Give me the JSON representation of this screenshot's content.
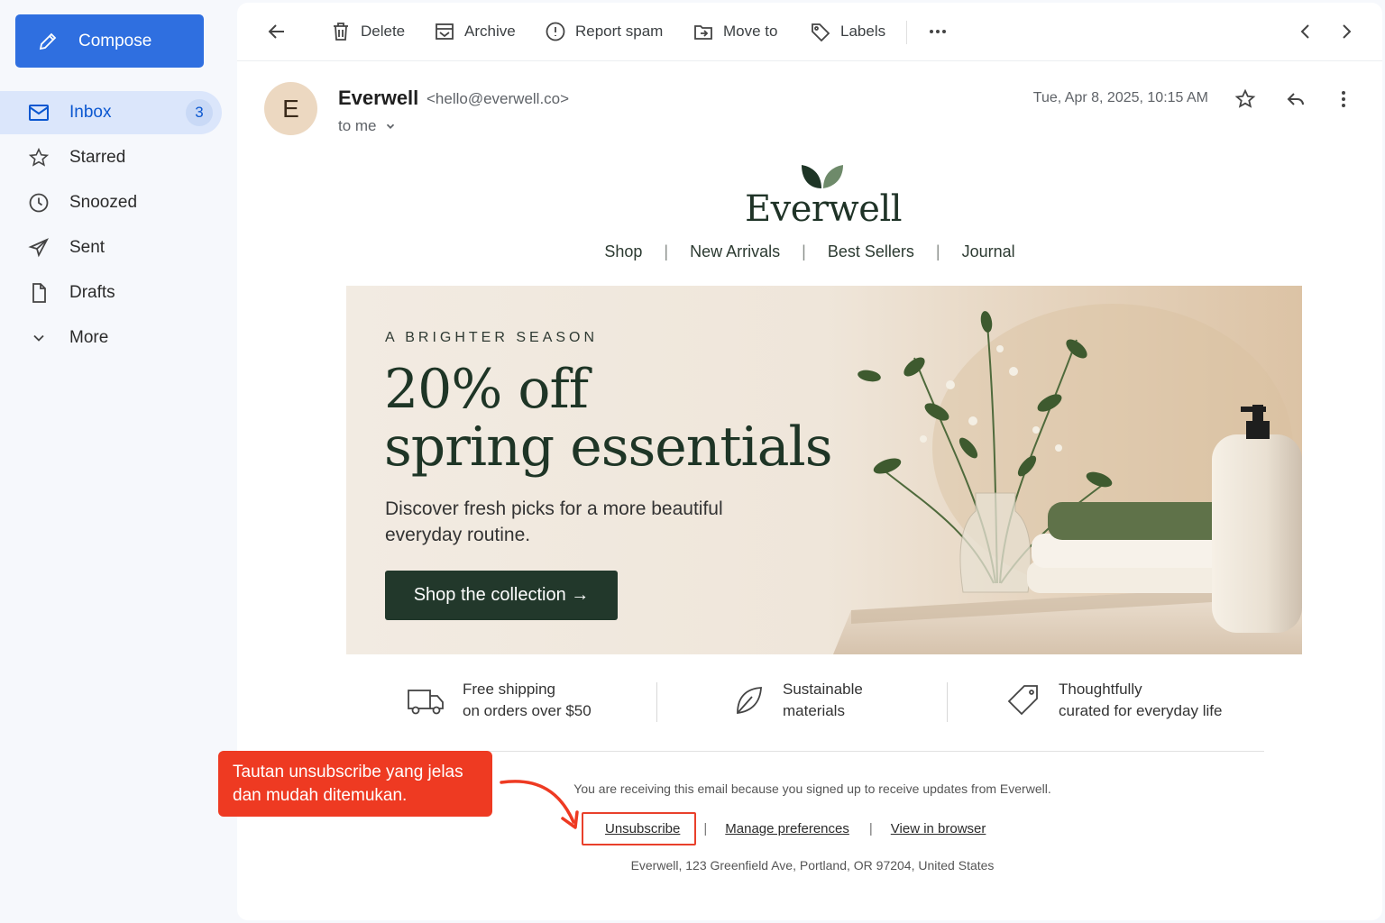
{
  "sidebar": {
    "compose_label": "Compose",
    "items": [
      {
        "label": "Inbox",
        "count": "3",
        "icon": "inbox-icon"
      },
      {
        "label": "Starred",
        "icon": "star-icon"
      },
      {
        "label": "Snoozed",
        "icon": "clock-icon"
      },
      {
        "label": "Sent",
        "icon": "send-icon"
      },
      {
        "label": "Drafts",
        "icon": "file-icon"
      },
      {
        "label": "More",
        "icon": "chevron-down-icon"
      }
    ]
  },
  "toolbar": {
    "delete": "Delete",
    "archive": "Archive",
    "report_spam": "Report spam",
    "move_to": "Move to",
    "labels": "Labels"
  },
  "message": {
    "avatar_letter": "E",
    "sender_name": "Everwell",
    "sender_email": "<hello@everwell.co>",
    "recipient": "to me",
    "date": "Tue, Apr 8, 2025, 10:15 AM"
  },
  "email": {
    "brand": "Everwell",
    "nav": [
      "Shop",
      "New Arrivals",
      "Best Sellers",
      "Journal"
    ],
    "hero": {
      "eyebrow": "A BRIGHTER SEASON",
      "headline_line1": "20% off",
      "headline_line2": "spring essentials",
      "subcopy": "Discover fresh picks for a more beautiful everyday routine.",
      "cta": "Shop the collection →"
    },
    "features": [
      {
        "line1": "Free shipping",
        "line2": "on orders over $50",
        "icon": "truck-icon"
      },
      {
        "line1": "Sustainable",
        "line2": "materials",
        "icon": "leaf-icon"
      },
      {
        "line1": "Thoughtfully",
        "line2": "curated for everyday life",
        "icon": "tag-icon"
      }
    ],
    "footer": {
      "notice": "You are receiving this email because you signed up to receive updates from Everwell.",
      "unsubscribe": "Unsubscribe",
      "manage": "Manage preferences",
      "view_browser": "View in browser",
      "address": "Everwell, 123 Greenfield Ave, Portland, OR 97204, United States"
    }
  },
  "annotation": {
    "callout_text": "Tautan unsubscribe yang jelas dan mudah ditemukan."
  },
  "colors": {
    "compose": "#2f6fe0",
    "brand_green": "#22382b",
    "callout_red": "#ee3a22"
  }
}
